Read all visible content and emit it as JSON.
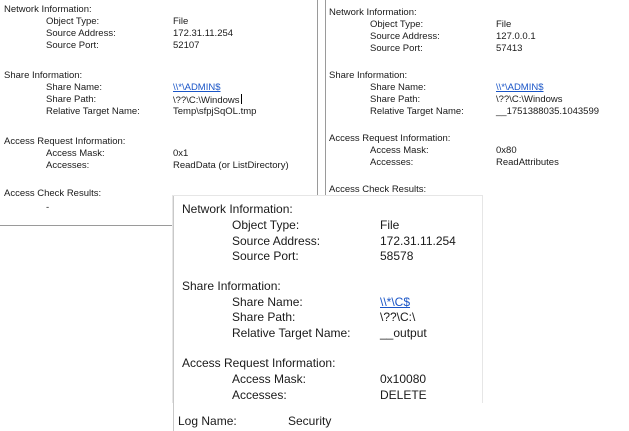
{
  "panel_a": {
    "network": {
      "header": "Network Information:",
      "object_type_label": "Object Type:",
      "object_type": "File",
      "source_address_label": "Source Address:",
      "source_address": "172.31.11.254",
      "source_port_label": "Source Port:",
      "source_port": "52107"
    },
    "share": {
      "header": "Share Information:",
      "share_name_label": "Share Name:",
      "share_name": "\\\\*\\ADMIN$",
      "share_path_label": "Share Path:",
      "share_path": "\\??\\C:\\Windows",
      "relative_target_label": "Relative Target Name:",
      "relative_target": "Temp\\sfpjSqOL.tmp"
    },
    "access": {
      "header": "Access Request Information:",
      "access_mask_label": "Access Mask:",
      "access_mask": "0x1",
      "accesses_label": "Accesses:",
      "accesses": "ReadData (or ListDirectory)"
    },
    "check": {
      "header": "Access Check Results:",
      "value": "-"
    }
  },
  "panel_b": {
    "network": {
      "header": "Network Information:",
      "object_type_label": "Object Type:",
      "object_type": "File",
      "source_address_label": "Source Address:",
      "source_address": "127.0.0.1",
      "source_port_label": "Source Port:",
      "source_port": "57413"
    },
    "share": {
      "header": "Share Information:",
      "share_name_label": "Share Name:",
      "share_name": "\\\\*\\ADMIN$",
      "share_path_label": "Share Path:",
      "share_path": "\\??\\C:\\Windows",
      "relative_target_label": "Relative Target Name:",
      "relative_target": "__1751388035.1043599"
    },
    "access": {
      "header": "Access Request Information:",
      "access_mask_label": "Access Mask:",
      "access_mask": "0x80",
      "accesses_label": "Accesses:",
      "accesses": "ReadAttributes"
    },
    "check": {
      "header": "Access Check Results:"
    }
  },
  "panel_c": {
    "network": {
      "header": "Network Information:",
      "object_type_label": "Object Type:",
      "object_type": "File",
      "source_address_label": "Source Address:",
      "source_address": "172.31.11.254",
      "source_port_label": "Source Port:",
      "source_port": "58578"
    },
    "share": {
      "header": "Share Information:",
      "share_name_label": "Share Name:",
      "share_name": "\\\\*\\C$",
      "share_path_label": "Share Path:",
      "share_path": "\\??\\C:\\",
      "relative_target_label": "Relative Target Name:",
      "relative_target": "__output"
    },
    "access": {
      "header": "Access Request Information:",
      "access_mask_label": "Access Mask:",
      "access_mask": "0x10080",
      "accesses_label": "Accesses:",
      "accesses": "DELETE"
    }
  },
  "panel_d": {
    "log_name_label": "Log Name:",
    "log_name": "Security"
  }
}
